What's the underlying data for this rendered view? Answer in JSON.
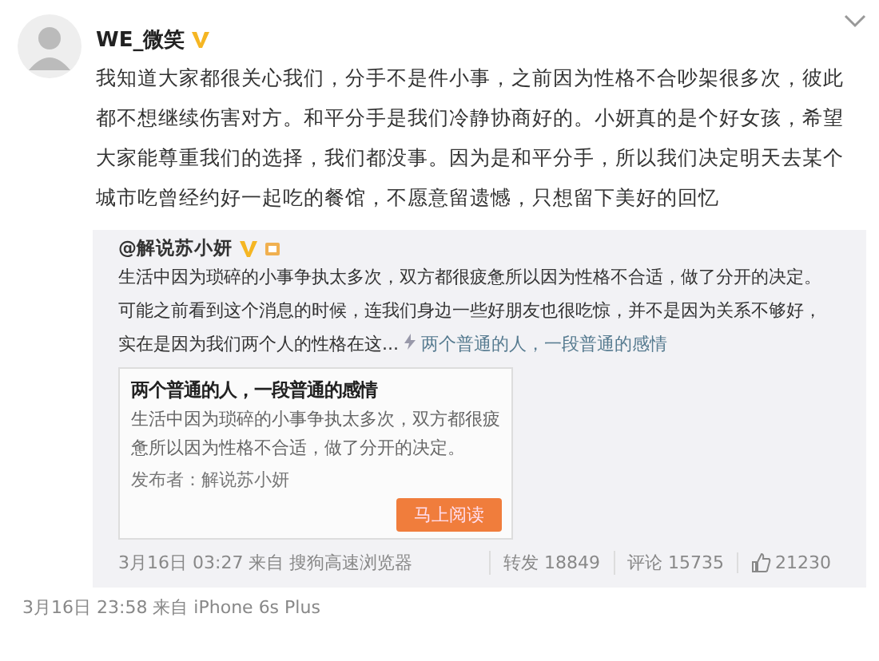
{
  "post": {
    "author": "WE_微笑",
    "verified": true,
    "body": "我知道大家都很关心我们，分手不是件小事，之前因为性格不合吵架很多次，彼此都不想继续伤害对方。和平分手是我们冷静协商好的。小妍真的是个好女孩，希望大家能尊重我们的选择，我们都没事。因为是和平分手，所以我们决定明天去某个城市吃曾经约好一起吃的餐馆，不愿意留遗憾，只想留下美好的回忆",
    "repost": {
      "author": "@解说苏小妍",
      "verified": true,
      "text": "生活中因为琐碎的小事争执太多次，双方都很疲惫所以因为性格不合适，做了分开的决定。可能之前看到这个消息的时候，连我们身边一些好朋友也很吃惊，并不是因为关系不够好，实在是因为我们两个人的性格在这...",
      "link": "两个普通的人，一段普通的感情",
      "card": {
        "title": "两个普通的人，一段普通的感情",
        "text": "生活中因为琐碎的小事争执太多次，双方都很疲惫所以因为性格不合适，做了分开的决定。",
        "publisher": "发布者：解说苏小妍",
        "button": "马上阅读"
      },
      "meta": "3月16日 03:27 来自 搜狗高速浏览器",
      "stats": [
        {
          "kind": "text",
          "label": "转发 18849"
        },
        {
          "kind": "text",
          "label": "评论 15735"
        },
        {
          "kind": "like",
          "label": "21230"
        }
      ]
    },
    "meta": "3月16日 23:58 来自 iPhone 6s Plus"
  }
}
